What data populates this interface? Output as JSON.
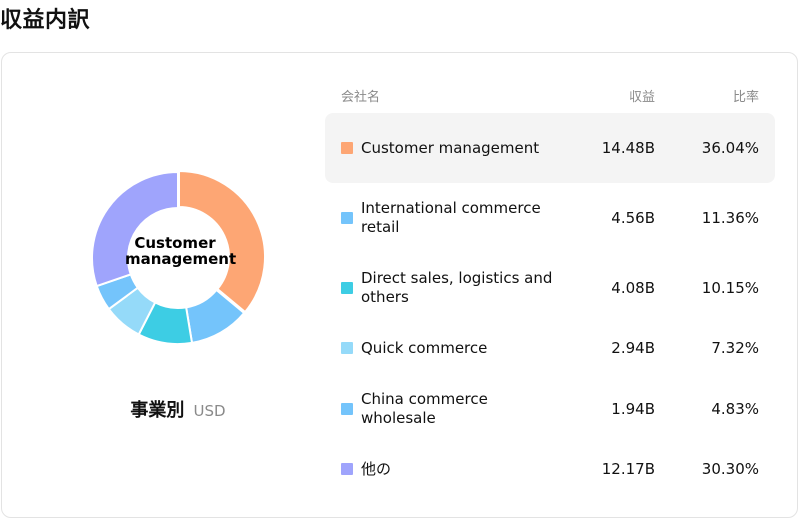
{
  "page": {
    "title": "収益内訳"
  },
  "donut": {
    "center_label": "Customer management"
  },
  "caption": {
    "main": "事業別",
    "unit": "USD"
  },
  "table": {
    "headers": {
      "name": "会社名",
      "revenue": "収益",
      "ratio": "比率"
    },
    "rows": [
      {
        "name": "Customer management",
        "revenue": "14.48B",
        "ratio": "36.04%",
        "color": "#fda674",
        "highlighted": true
      },
      {
        "name": "International commerce retail",
        "revenue": "4.56B",
        "ratio": "11.36%",
        "color": "#74c4fb",
        "highlighted": false
      },
      {
        "name": "Direct sales, logistics and others",
        "revenue": "4.08B",
        "ratio": "10.15%",
        "color": "#3dcde4",
        "highlighted": false
      },
      {
        "name": "Quick commerce",
        "revenue": "2.94B",
        "ratio": "7.32%",
        "color": "#95daf9",
        "highlighted": false
      },
      {
        "name": "China commerce wholesale",
        "revenue": "1.94B",
        "ratio": "4.83%",
        "color": "#74c4fb",
        "highlighted": false
      },
      {
        "name": "他の",
        "revenue": "12.17B",
        "ratio": "30.30%",
        "color": "#9fa4fc",
        "highlighted": false
      }
    ]
  },
  "chart_data": {
    "type": "pie",
    "categories": [
      "Customer management",
      "International commerce retail",
      "Direct sales, logistics and others",
      "Quick commerce",
      "China commerce wholesale",
      "他の"
    ],
    "values": [
      36.04,
      11.36,
      10.15,
      7.32,
      4.83,
      30.3
    ],
    "colors": [
      "#fda674",
      "#74c4fb",
      "#3dcde4",
      "#95daf9",
      "#74c4fb",
      "#9fa4fc"
    ]
  }
}
